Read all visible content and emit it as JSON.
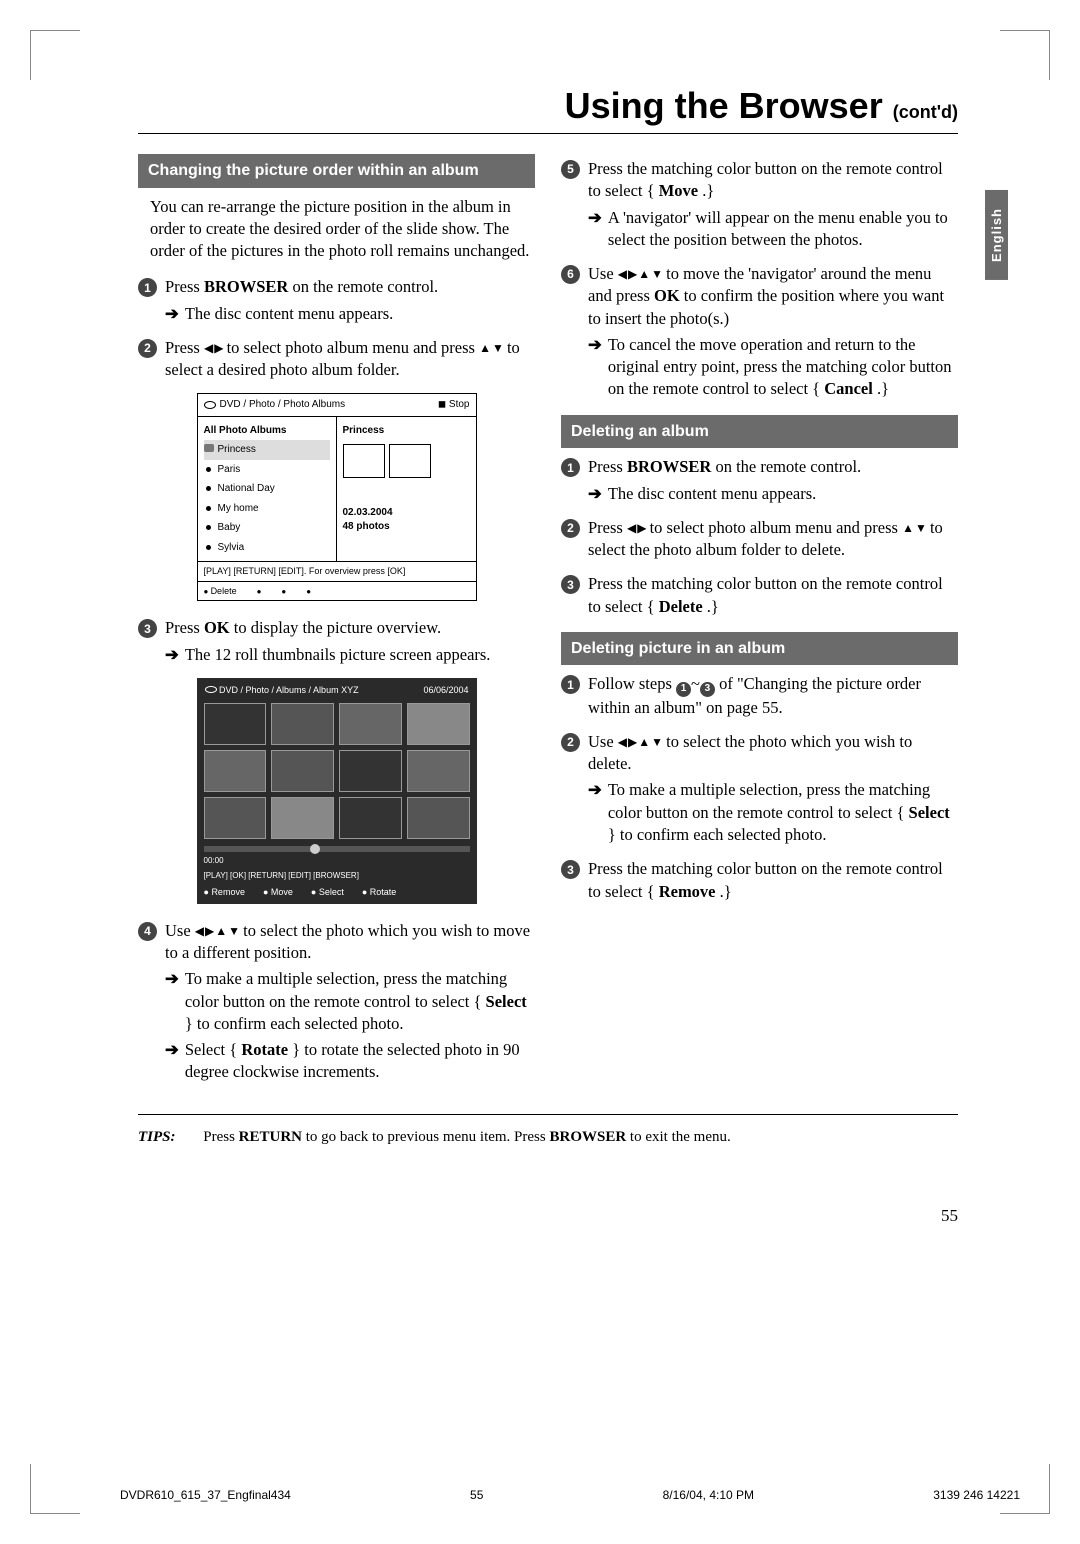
{
  "title_main": "Using the Browser",
  "title_contd": "(cont'd)",
  "language_tab": "English",
  "sections": {
    "s1": "Changing the picture order within an album",
    "s2": "Deleting an album",
    "s3": "Deleting picture in an album"
  },
  "intro1": "You can re-arrange the picture position in the album in order to create the desired order of the slide show.  The order of the pictures in the photo roll remains unchanged.",
  "left": {
    "step1_a": "Press ",
    "step1_b": "BROWSER",
    "step1_c": " on the remote control.",
    "step1_sub": "The disc content menu appears.",
    "step2_a": "Press ",
    "step2_arrows_lr": "◀ ▶",
    "step2_b": " to select photo album menu and press ",
    "step2_arrows_ud": "▲ ▼",
    "step2_c": " to select a desired photo album folder.",
    "step3_a": "Press ",
    "step3_b": "OK",
    "step3_c": " to display the picture overview.",
    "step3_sub": "The 12 roll thumbnails picture screen appears.",
    "step4_a": "Use ",
    "step4_arrows": "◀ ▶ ▲ ▼",
    "step4_b": " to select the photo which you wish to move to a different position.",
    "step4_sub1a": "To make a multiple selection, press the matching color button on the remote control to select { ",
    "step4_sub1b": "Select",
    "step4_sub1c": " } to confirm each selected photo.",
    "step4_sub2a": "Select { ",
    "step4_sub2b": "Rotate",
    "step4_sub2c": " } to rotate the selected photo in 90 degree clockwise increments."
  },
  "right": {
    "step5_a": "Press the matching color button on the remote control to select { ",
    "step5_b": "Move",
    "step5_c": " .}",
    "step5_sub": "A 'navigator' will appear on the menu enable you to select the position between the photos.",
    "step6_a": "Use ",
    "step6_arrows": "◀ ▶ ▲ ▼",
    "step6_b": " to move the 'navigator' around the menu and press ",
    "step6_c": "OK",
    "step6_d": " to confirm the position where you want to insert the photo(s.)",
    "step6_sub_a": "To cancel the move operation and return to the original entry point, press the matching color button on the remote control to select { ",
    "step6_sub_b": "Cancel",
    "step6_sub_c": " .}",
    "del_step1_a": "Press ",
    "del_step1_b": "BROWSER",
    "del_step1_c": " on the remote control.",
    "del_step1_sub": "The disc content menu appears.",
    "del_step2_a": "Press ",
    "del_step2_b": " to select photo album menu and press ",
    "del_step2_c": " to select the photo album folder to delete.",
    "del_step3_a": "Press the matching color button on the remote control to select { ",
    "del_step3_b": "Delete",
    "del_step3_c": " .}",
    "dp_step1_a": "Follow steps ",
    "dp_step1_b": " of \"Changing the picture order within an album\" on page 55.",
    "dp_step2_a": "Use ",
    "dp_step2_b": " to select the photo which you wish to delete.",
    "dp_step2_sub_a": "To make a multiple selection, press the matching color button on the remote control to select { ",
    "dp_step2_sub_b": "Select",
    "dp_step2_sub_c": " } to confirm each selected photo.",
    "dp_step3_a": "Press the matching color button on the remote control to select { ",
    "dp_step3_b": "Remove",
    "dp_step3_c": " .}"
  },
  "menu1": {
    "breadcrumb": "DVD / Photo / Photo Albums",
    "stop": "◼ Stop",
    "left_header": "All Photo Albums",
    "right_header": "Princess",
    "items": [
      "Princess",
      "Paris",
      "National Day",
      "My home",
      "Baby",
      "Sylvia"
    ],
    "date": "02.03.2004",
    "count": "48 photos",
    "hint": "[PLAY] [RETURN] [EDIT].  For overview press [OK]",
    "action": "Delete"
  },
  "menu2": {
    "breadcrumb": "DVD / Photo / Albums / Album XYZ",
    "date": "06/06/2004",
    "time": "00:00",
    "hint": "[PLAY] [OK] [RETURN] [EDIT] [BROWSER]",
    "a1": "Remove",
    "a2": "Move",
    "a3": "Select",
    "a4": "Rotate"
  },
  "tips": {
    "label": "TIPS:",
    "body_a": "Press ",
    "body_b": "RETURN",
    "body_c": " to go back to previous menu item.  Press ",
    "body_d": "BROWSER",
    "body_e": " to exit the menu."
  },
  "page_number": "55",
  "footer": {
    "file": "DVDR610_615_37_Engfinal434",
    "page": "55",
    "date": "8/16/04, 4:10 PM",
    "code": "3139 246 14221"
  }
}
